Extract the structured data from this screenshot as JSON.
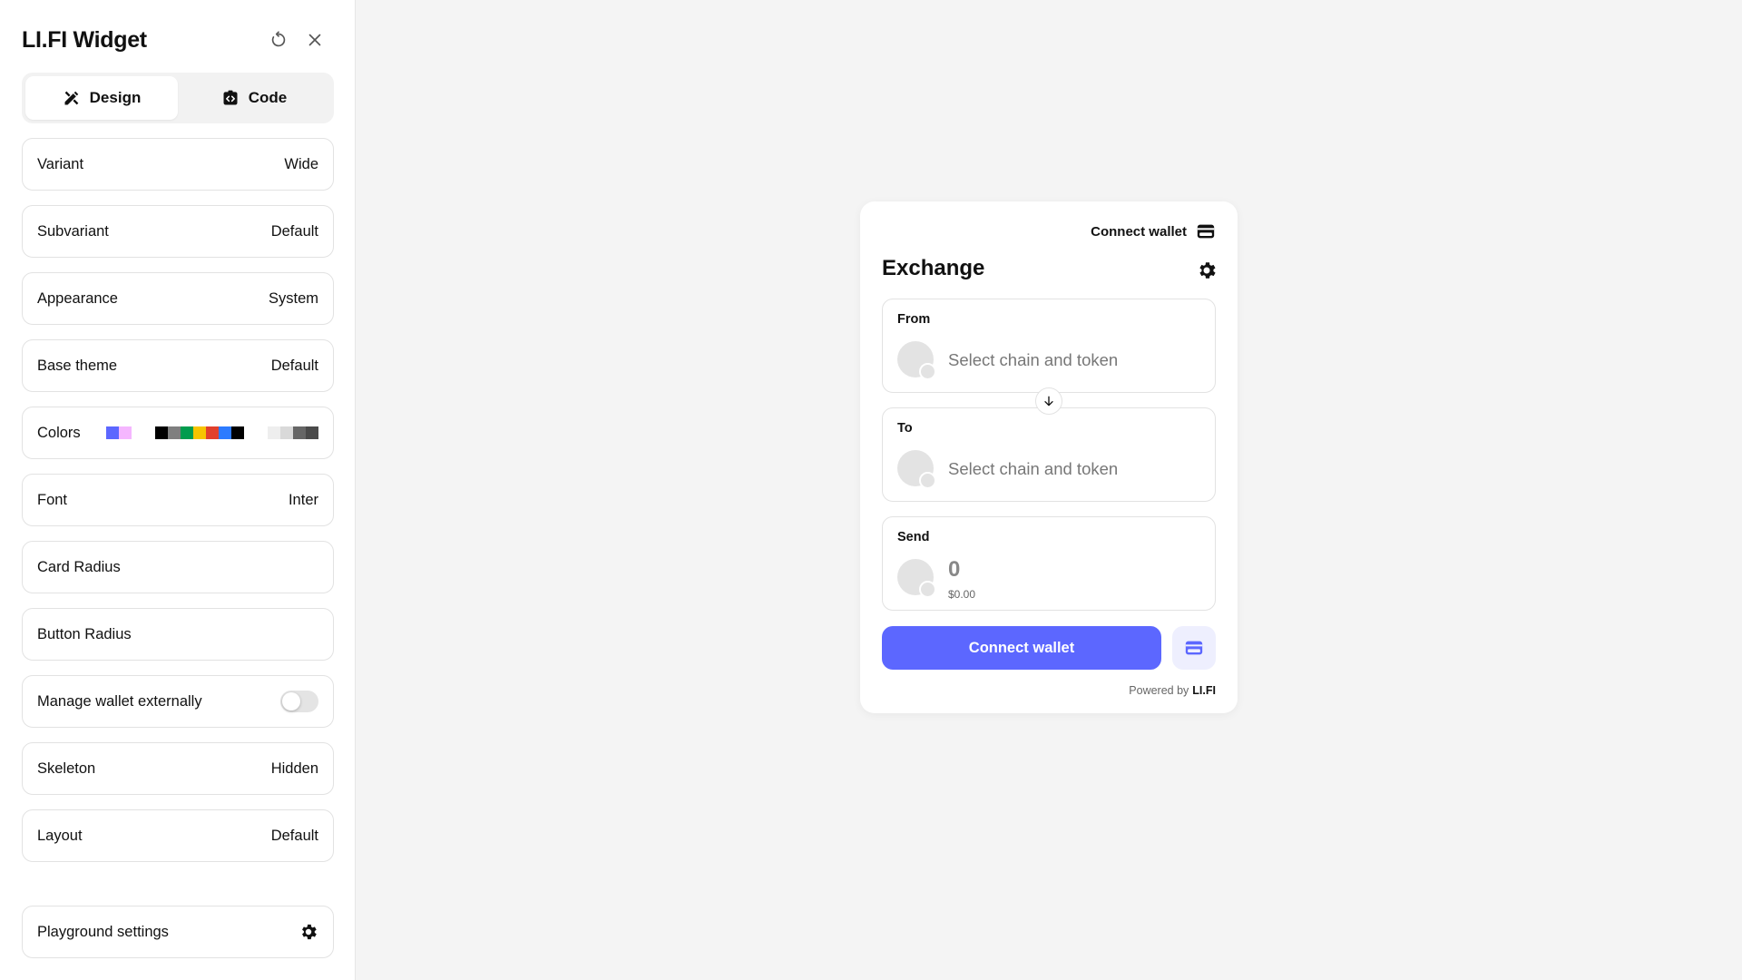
{
  "sidebar": {
    "title": "LI.FI Widget",
    "tabs": [
      {
        "label": "Design",
        "active": true
      },
      {
        "label": "Code",
        "active": false
      }
    ],
    "options": [
      {
        "label": "Variant",
        "value": "Wide"
      },
      {
        "label": "Subvariant",
        "value": "Default"
      },
      {
        "label": "Appearance",
        "value": "System"
      },
      {
        "label": "Base theme",
        "value": "Default"
      },
      {
        "label": "Colors"
      },
      {
        "label": "Font",
        "value": "Inter"
      },
      {
        "label": "Card Radius",
        "value": ""
      },
      {
        "label": "Button Radius",
        "value": ""
      },
      {
        "label": "Manage wallet externally",
        "toggle": false
      },
      {
        "label": "Skeleton",
        "value": "Hidden"
      },
      {
        "label": "Layout",
        "value": "Default"
      }
    ],
    "colors": {
      "primary": [
        "#5c67ff",
        "#f5b6ff"
      ],
      "palette": [
        "#000000",
        "#7f7f7f",
        "#009c4e",
        "#f7c400",
        "#e1402c",
        "#2d7bff",
        "#000000"
      ],
      "grays": [
        "#eeeeee",
        "#d9d9d9",
        "#666666",
        "#4a4a4a"
      ]
    },
    "playground_label": "Playground settings"
  },
  "widget": {
    "connect_wallet_top": "Connect wallet",
    "title": "Exchange",
    "from_label": "From",
    "to_label": "To",
    "select_placeholder": "Select chain and token",
    "send_label": "Send",
    "amount": "0",
    "amount_usd": "$0.00",
    "connect_button": "Connect wallet",
    "powered_by": "Powered by",
    "brand": "LI.FI",
    "accent": "#5c67ff"
  }
}
